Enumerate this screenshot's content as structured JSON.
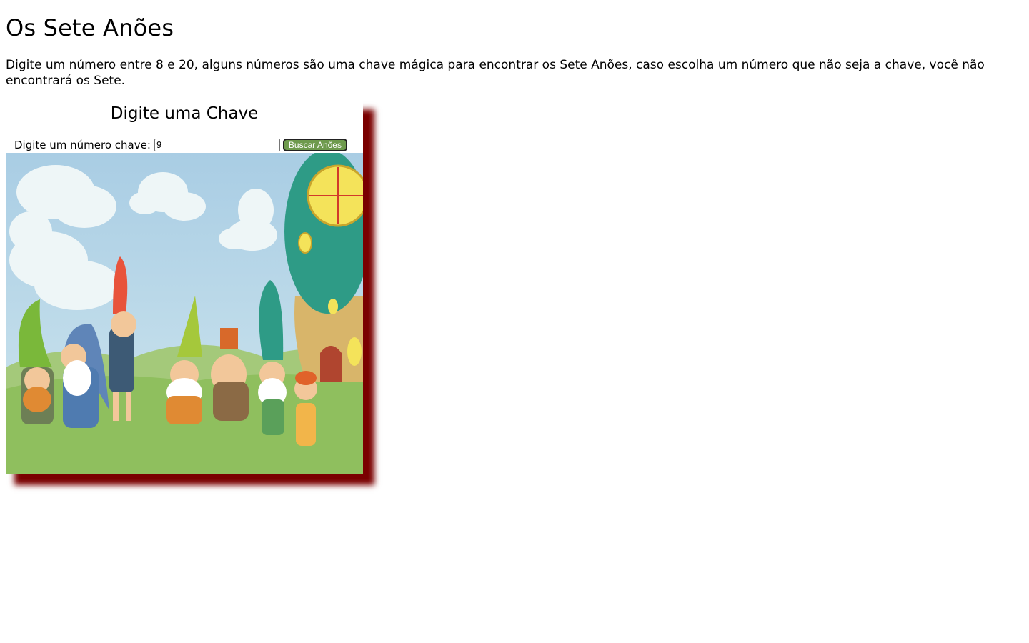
{
  "page": {
    "title": "Os Sete Anões",
    "intro": "Digite um número entre 8 e 20, alguns números são uma chave mágica para encontrar os Sete Anões, caso escolha um número que não seja a chave, você não encontrará os Sete."
  },
  "card": {
    "title": "Digite uma Chave",
    "label": "Digite um número chave:",
    "input_value": "9",
    "button_label": "Buscar Anões"
  },
  "colors": {
    "card_shadow": "#7a0000",
    "button_bg": "#6e9a4d"
  }
}
